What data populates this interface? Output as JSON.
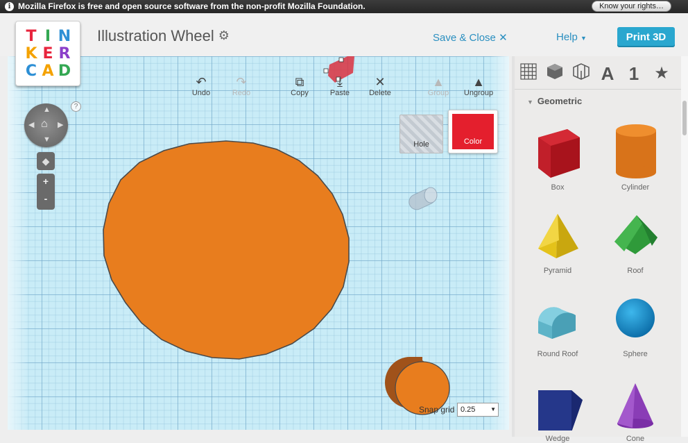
{
  "notification": {
    "message": "Mozilla Firefox is free and open source software from the non-profit Mozilla Foundation.",
    "button": "Know your rights…"
  },
  "logo": {
    "rows": [
      [
        "T",
        "I",
        "N"
      ],
      [
        "K",
        "E",
        "R"
      ],
      [
        "C",
        "A",
        "D"
      ]
    ],
    "colors": [
      "#e8253d",
      "#34a853",
      "#2d8fd5",
      "#f4a200",
      "#e8253d",
      "#8b3fc9",
      "#2d8fd5",
      "#f4a200",
      "#34a853"
    ]
  },
  "header": {
    "title": "Illustration Wheel",
    "save_close": "Save & Close",
    "help": "Help",
    "print": "Print 3D"
  },
  "toolbar": {
    "undo": "Undo",
    "redo": "Redo",
    "copy": "Copy",
    "paste": "Paste",
    "delete": "Delete",
    "group": "Group",
    "ungroup": "Ungroup"
  },
  "inspector": {
    "hole": "Hole",
    "color": "Color",
    "color_value": "#e41f2d"
  },
  "snap": {
    "label": "Snap grid",
    "value": "0.25"
  },
  "shapes_panel": {
    "category": "Geometric",
    "category_tabs": [
      "grid",
      "box",
      "cage",
      "A",
      "1",
      "star"
    ],
    "items": [
      "Box",
      "Cylinder",
      "Pyramid",
      "Roof",
      "Round Roof",
      "Sphere",
      "Wedge",
      "Cone"
    ]
  },
  "scene": {
    "object_color": "#e87d1e"
  }
}
